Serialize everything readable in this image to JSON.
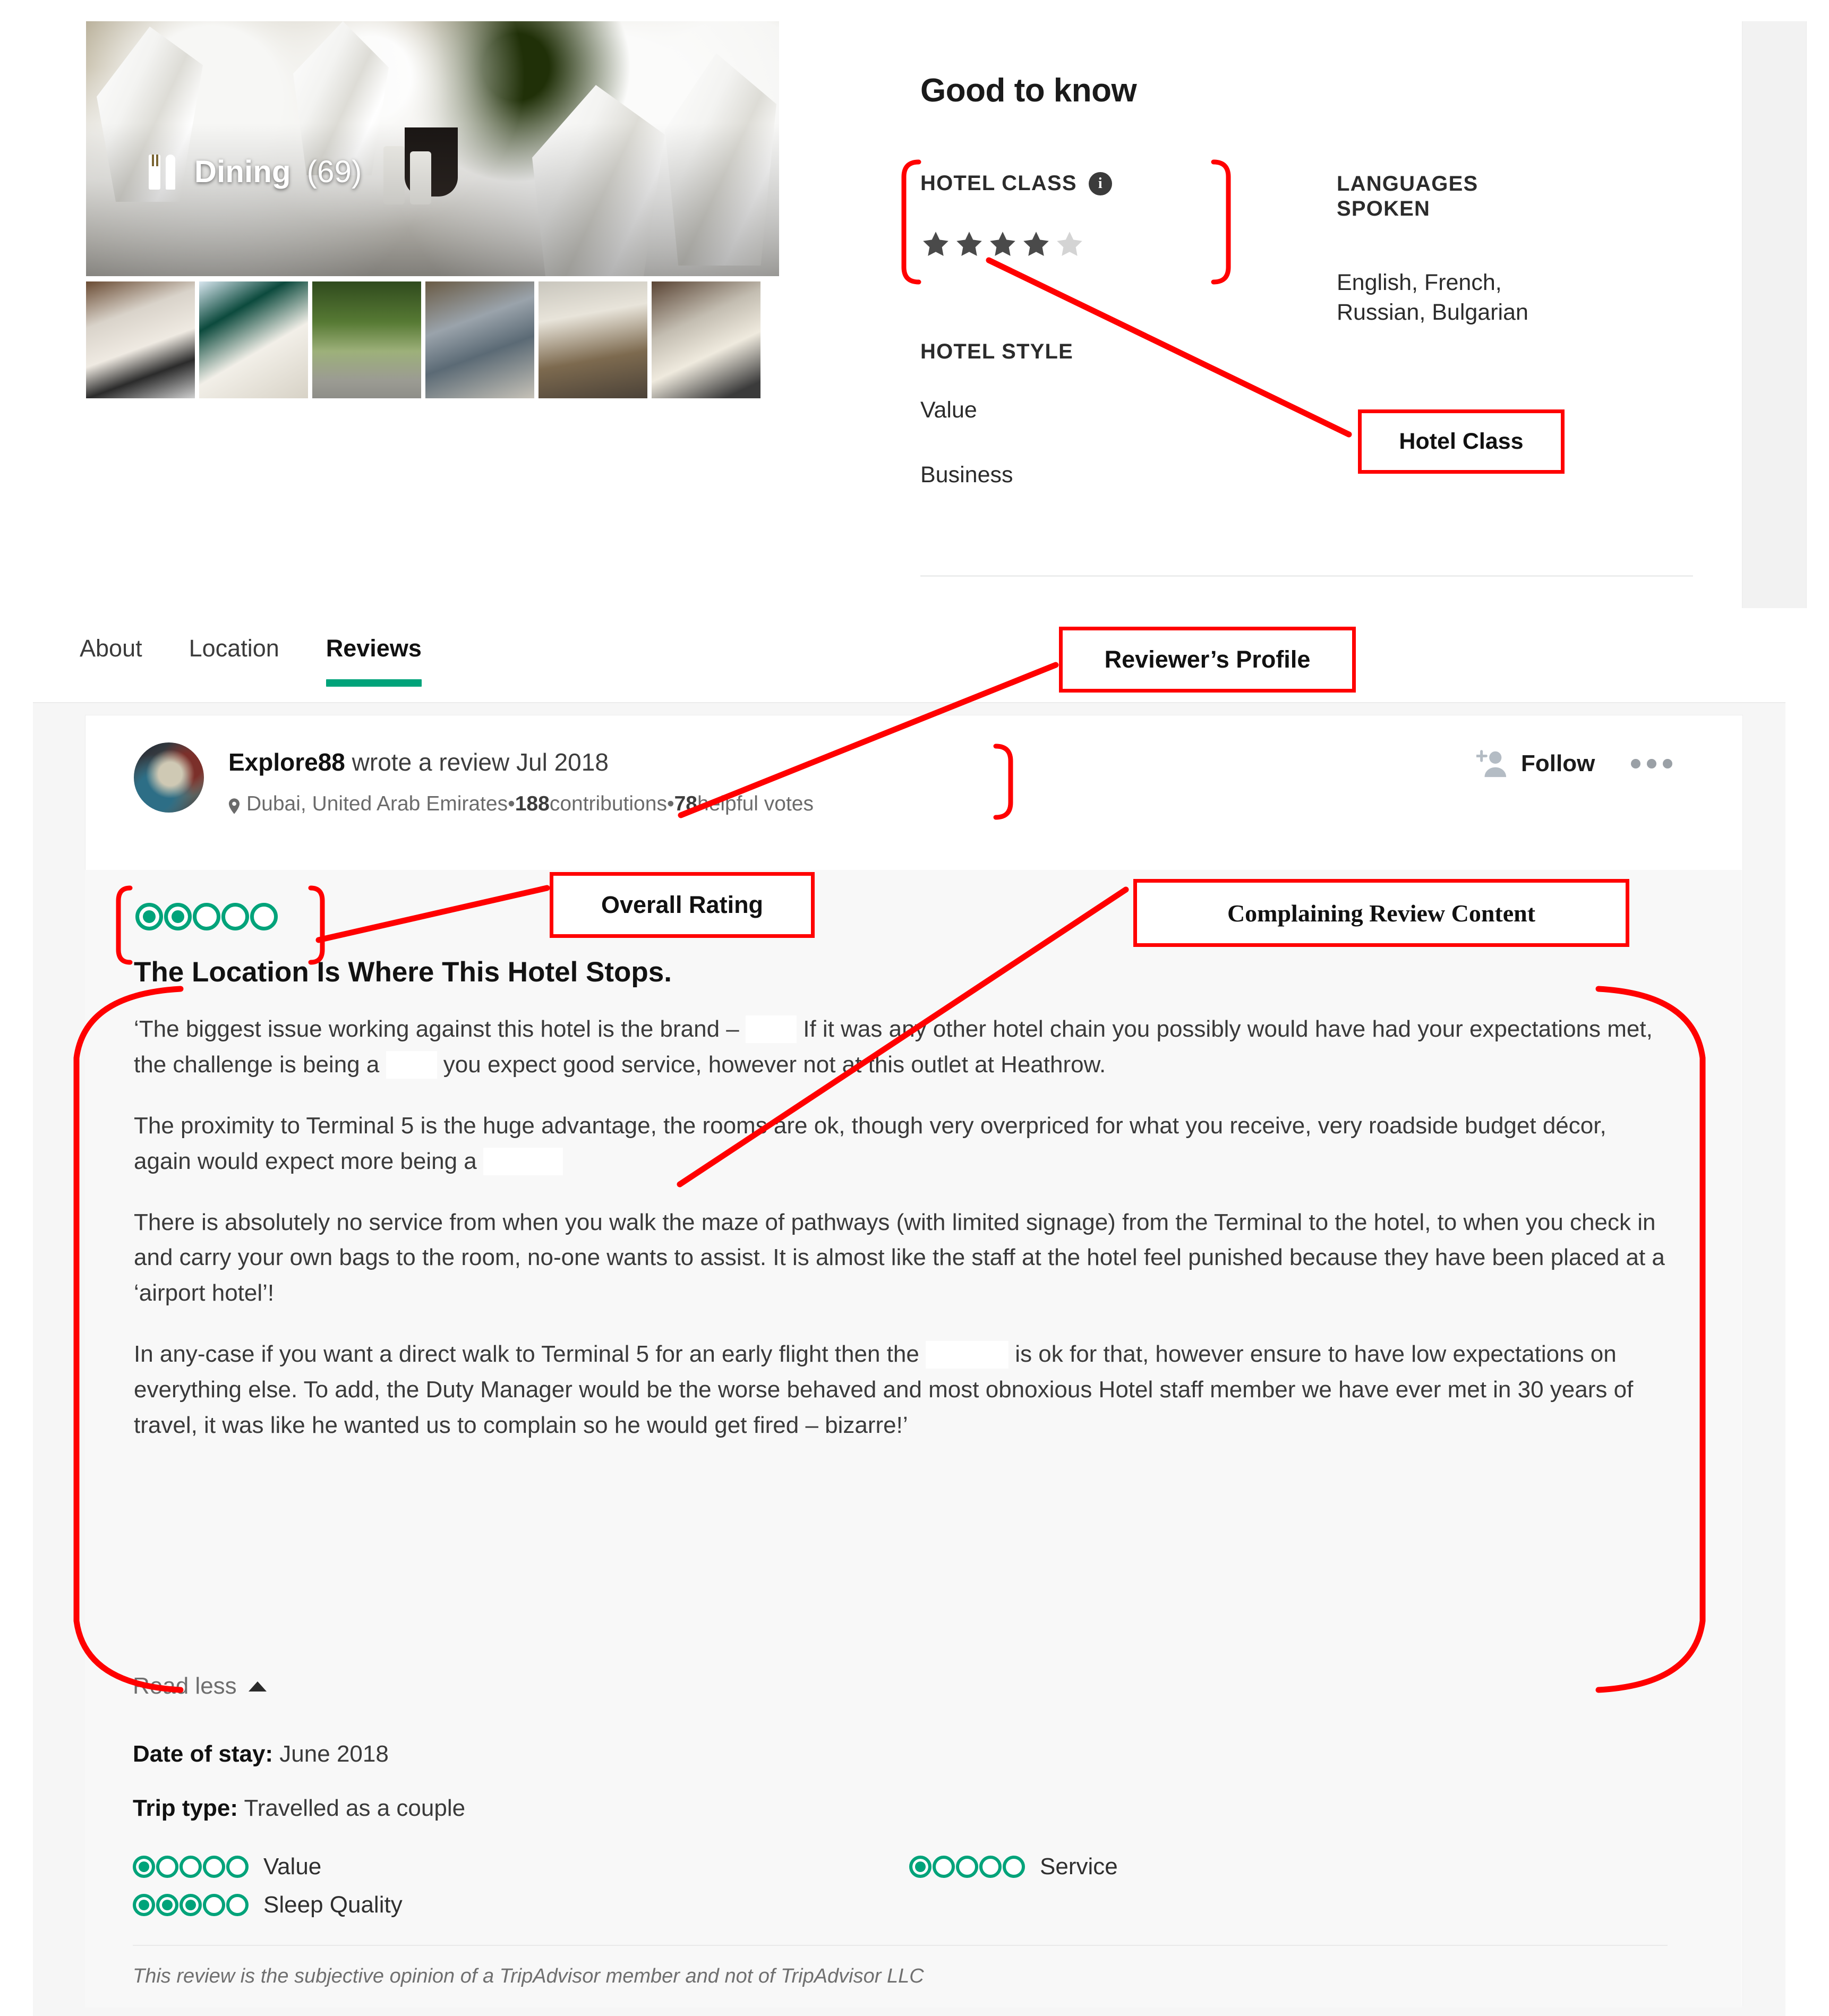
{
  "gallery": {
    "hero_label": "Dining",
    "hero_count": "(69)",
    "icon": "cutlery-icon",
    "thumb_count": 6
  },
  "good_to_know": {
    "title": "Good to know",
    "hotel_class": {
      "label": "HOTEL CLASS",
      "info_icon": "info-icon",
      "stars_filled": 4,
      "stars_total": 5,
      "star_filled_color": "#4a4a4a",
      "star_empty_color": "#d4d4d4"
    },
    "hotel_style": {
      "label": "HOTEL STYLE",
      "values": [
        "Value",
        "Business"
      ]
    },
    "languages": {
      "label_line1": "LANGUAGES",
      "label_line2": "SPOKEN",
      "value_line1": "English, French,",
      "value_line2": "Russian, Bulgarian"
    }
  },
  "tabs": [
    {
      "label": "About",
      "active": false
    },
    {
      "label": "Location",
      "active": false
    },
    {
      "label": "Reviews",
      "active": true
    }
  ],
  "accent_color": "#00a37a",
  "annotation_color": "#ff0000",
  "review": {
    "reviewer": "Explore88",
    "action": " wrote a review Jul 2018",
    "location": "Dubai, United Arab Emirates",
    "separator": " • ",
    "contributions_count": "188",
    "contributions_label": " contributions",
    "helpful_count": "78",
    "helpful_label": " helpful votes",
    "follow_label": "Follow",
    "more_icon": "ellipsis-icon",
    "follow_icon": "add-person-icon",
    "location_icon": "map-pin-icon",
    "overall_rating": 2,
    "rating_total": 5,
    "title": "The Location Is Where This Hotel Stops.",
    "paragraphs": [
      {
        "segments": [
          {
            "type": "text",
            "value": "‘The biggest issue working against this hotel is the brand – "
          },
          {
            "type": "redacted",
            "width": 96
          },
          {
            "type": "text",
            "value": " If it was any other hotel chain you possibly would have had your expectations met, the challenge is being a "
          },
          {
            "type": "redacted",
            "width": 96
          },
          {
            "type": "text",
            "value": " you expect good service, however not at this outlet at Heathrow."
          }
        ]
      },
      {
        "segments": [
          {
            "type": "text",
            "value": "The proximity to Terminal 5 is the huge advantage, the rooms are ok, though very overpriced for what you receive, very roadside budget décor, again would expect more being a "
          },
          {
            "type": "redacted",
            "width": 150
          }
        ]
      },
      {
        "segments": [
          {
            "type": "text",
            "value": "There is absolutely no service from when you walk the maze of pathways (with limited signage) from the Terminal to the hotel, to when you check in and carry your own bags to the room, no-one wants to assist. It is almost like the staff at the hotel feel punished because they have been placed at a ‘airport hotel’!"
          }
        ]
      },
      {
        "segments": [
          {
            "type": "text",
            "value": "In any-case if you want a direct walk to Terminal 5 for an early flight then the "
          },
          {
            "type": "redacted",
            "width": 156
          },
          {
            "type": "text",
            "value": " is ok for that, however ensure to have low expectations on everything else. To add, the Duty Manager would be the worse behaved and most obnoxious Hotel staff member we have ever met in 30 years of travel, it was like he wanted us to complain so he would get fired – bizarre!’"
          }
        ]
      }
    ],
    "read_less_label": "Read less",
    "date_of_stay_label": "Date of stay:",
    "date_of_stay_value": " June 2018",
    "trip_type_label": "Trip type:",
    "trip_type_value": " Travelled as a couple",
    "sub_ratings": [
      {
        "label": "Value",
        "value": 1,
        "total": 5
      },
      {
        "label": "Sleep Quality",
        "value": 3,
        "total": 5
      },
      {
        "label": "Service",
        "value": 1,
        "total": 5
      }
    ],
    "disclaimer": "This review is the subjective opinion of a TripAdvisor member and not of TripAdvisor LLC"
  },
  "annotations": [
    {
      "id": "hotel-class",
      "label": "Hotel Class"
    },
    {
      "id": "reviewer-profile",
      "label": "Reviewer’s Profile"
    },
    {
      "id": "overall-rating",
      "label": "Overall Rating"
    },
    {
      "id": "complaining-review-content",
      "label": "Complaining Review Content"
    }
  ]
}
